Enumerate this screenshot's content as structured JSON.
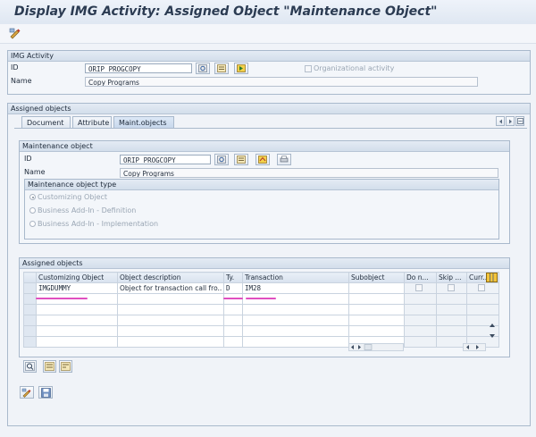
{
  "window": {
    "title": "Display IMG Activity: Assigned Object \"Maintenance Object\""
  },
  "toolbar": {
    "icons": [
      "display-change-icon"
    ]
  },
  "img_activity": {
    "header": "IMG Activity",
    "id_label": "ID",
    "id_value": "ORIP_PROGCOPY",
    "name_label": "Name",
    "name_value": "Copy Programs",
    "org_activity_label": "Organizational activity"
  },
  "assigned_objects_section": {
    "header": "Assigned objects"
  },
  "tabs": [
    {
      "label": "Document"
    },
    {
      "label": "Attribute"
    },
    {
      "label": "Maint.objects"
    }
  ],
  "maintenance_object": {
    "header": "Maintenance object",
    "id_label": "ID",
    "id_value": "ORIP_PROGCOPY",
    "name_label": "Name",
    "name_value": "Copy Programs",
    "type_header": "Maintenance object type",
    "types": [
      {
        "label": "Customizing Object",
        "selected": true
      },
      {
        "label": "Business Add-In - Definition",
        "selected": false
      },
      {
        "label": "Business Add-In - Implementation",
        "selected": false
      }
    ]
  },
  "assigned_table": {
    "header": "Assigned objects",
    "columns": [
      "Customizing Object",
      "Object description",
      "Ty.",
      "Transaction",
      "Subobject",
      "Do n...",
      "Skip ...",
      "Curr..."
    ],
    "rows": [
      [
        "IMGDUMMY",
        "Object for transaction call fro..",
        "D",
        "IM28",
        "",
        "",
        "",
        ""
      ]
    ]
  },
  "colors": {
    "accent": "#e04fc0",
    "header_bg": "#dfe7f2"
  }
}
